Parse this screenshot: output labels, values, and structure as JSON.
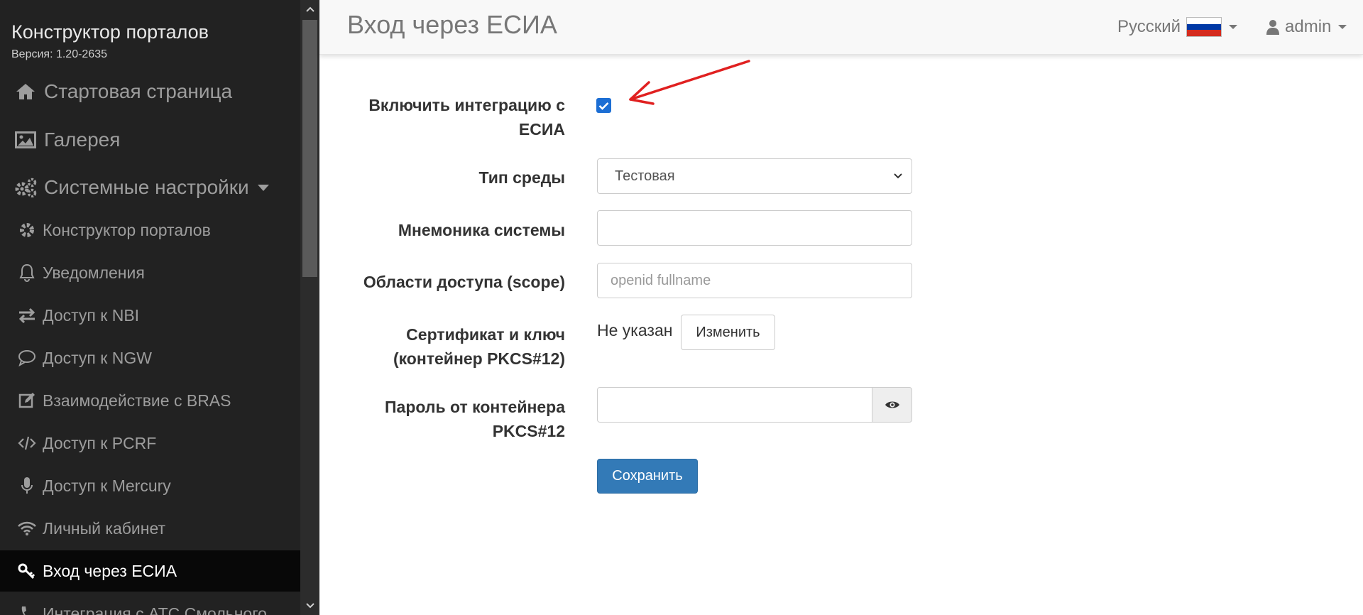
{
  "sidebar": {
    "brand": "Конструктор порталов",
    "version": "Версия: 1.20-2635",
    "top_items": [
      {
        "label": "Стартовая страница",
        "icon": "home-icon"
      },
      {
        "label": "Галерея",
        "icon": "image-icon"
      },
      {
        "label": "Системные настройки",
        "icon": "cogs-icon"
      }
    ],
    "sub_items": [
      {
        "label": "Конструктор порталов",
        "icon": "gear-icon"
      },
      {
        "label": "Уведомления",
        "icon": "bell-icon"
      },
      {
        "label": "Доступ к NBI",
        "icon": "exchange-icon"
      },
      {
        "label": "Доступ к NGW",
        "icon": "comment-icon"
      },
      {
        "label": "Взаимодействие с BRAS",
        "icon": "edit-icon"
      },
      {
        "label": "Доступ к PCRF",
        "icon": "code-icon"
      },
      {
        "label": "Доступ к Mercury",
        "icon": "microphone-icon"
      },
      {
        "label": "Личный кабинет",
        "icon": "wifi-icon"
      },
      {
        "label": "Вход через ЕСИА",
        "icon": "key-icon",
        "active": true
      },
      {
        "label": "Интеграция с АТС Смольного",
        "icon": "phone-icon"
      }
    ]
  },
  "header": {
    "title": "Вход через ЕСИА",
    "language": "Русский",
    "user": "admin"
  },
  "form": {
    "enable_label": "Включить интеграцию с ЕСИА",
    "enable_checked": true,
    "env_label": "Тип среды",
    "env_value": "Тестовая",
    "mnemonic_label": "Мнемоника системы",
    "mnemonic_value": "",
    "scope_label": "Области доступа (scope)",
    "scope_placeholder": "openid fullname",
    "cert_label": "Сертификат и ключ (контейнер PKCS#12)",
    "cert_status": "Не указан",
    "cert_button": "Изменить",
    "password_label": "Пароль от контейнера PKCS#12",
    "save_button": "Сохранить"
  },
  "colors": {
    "sidebar_bg": "#222222",
    "primary": "#337ab7",
    "checkbox": "#1c6ed4",
    "arrow": "#e02020"
  }
}
